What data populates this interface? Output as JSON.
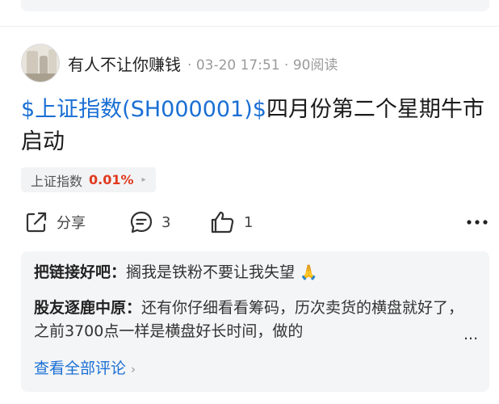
{
  "post": {
    "author": "有人不让你赚钱",
    "separator1": " · ",
    "time": "03-20 17:51",
    "separator2": " · ",
    "views": "90阅读",
    "title_link": "$上证指数(SH000001)$",
    "title_text": "四月份第二个星期牛市启动"
  },
  "stock_tag": {
    "name": "上证指数",
    "change": "0.01%",
    "arrow": "▸"
  },
  "actions": {
    "share_label": "分享",
    "comment_count": "3",
    "like_count": "1"
  },
  "comments": [
    {
      "author": "把链接好吧：",
      "text": "搁我是铁粉不要让我失望",
      "emoji": "🙏"
    },
    {
      "author": "股友逐鹿中原：",
      "text": "还有你仔细看看筹码，历次卖货的横盘就好了，之前3700点一样是横盘好长时间，做的"
    }
  ],
  "comments_more": "...",
  "view_all": "查看全部评论",
  "view_all_chevron": "›",
  "colors": {
    "link": "#1a6fd4",
    "up": "#e03a1e",
    "card_bg": "#f4f5f7"
  },
  "icons": [
    "share-icon",
    "comment-icon",
    "like-icon",
    "more-icon",
    "chevron-right-icon"
  ]
}
